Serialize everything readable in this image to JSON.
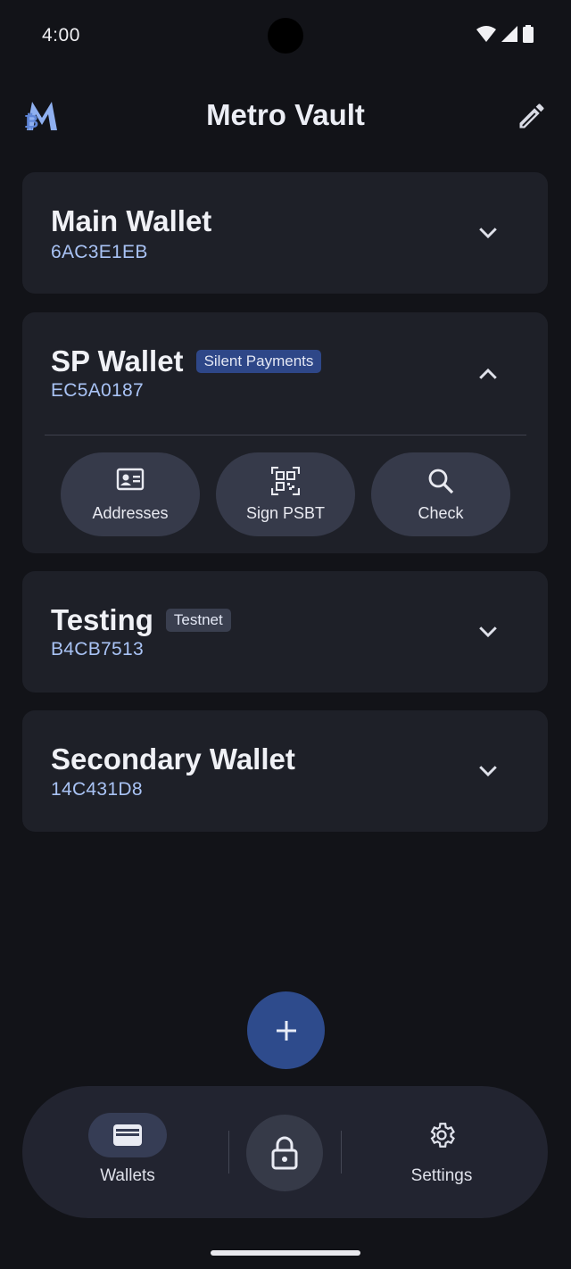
{
  "status": {
    "time": "4:00"
  },
  "app": {
    "title": "Metro Vault"
  },
  "wallets": [
    {
      "name": "Main Wallet",
      "fingerprint": "6AC3E1EB",
      "badge": "",
      "expanded": false
    },
    {
      "name": "SP Wallet",
      "fingerprint": "EC5A0187",
      "badge": "Silent Payments",
      "expanded": true
    },
    {
      "name": "Testing",
      "fingerprint": "B4CB7513",
      "badge": "Testnet",
      "expanded": false
    },
    {
      "name": "Secondary Wallet",
      "fingerprint": "14C431D8",
      "badge": "",
      "expanded": false
    }
  ],
  "actions": [
    {
      "label": "Addresses",
      "icon": "contact-card-icon"
    },
    {
      "label": "Sign PSBT",
      "icon": "qr-code-icon"
    },
    {
      "label": "Check",
      "icon": "search-icon"
    }
  ],
  "nav": {
    "wallets": "Wallets",
    "settings": "Settings"
  },
  "colors": {
    "background": "#121318",
    "card": "#1e2028",
    "accent": "#2e4b8c",
    "fingerprint": "#a9c3f5"
  }
}
